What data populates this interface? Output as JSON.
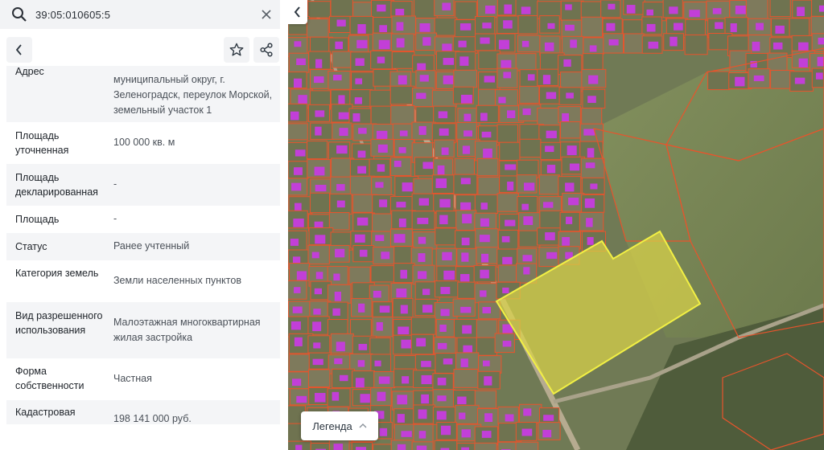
{
  "search": {
    "query": "39:05:010605:5"
  },
  "toolbar": {
    "back": "back",
    "favorite": "star",
    "share": "share"
  },
  "rows": [
    {
      "label": "Адрес",
      "value": "муниципальный округ, г. Зеленоградск, переулок Морской, земельный участок 1"
    },
    {
      "label": "Площадь уточненная",
      "value": "100 000 кв. м"
    },
    {
      "label": "Площадь декларированная",
      "value": "-"
    },
    {
      "label": "Площадь",
      "value": "-"
    },
    {
      "label": "Статус",
      "value": "Ранее учтенный"
    },
    {
      "label": "Категория земель",
      "value": "Земли населенных пунктов"
    },
    {
      "label": "Вид разрешенного использования",
      "value": "Малоэтажная многоквартирная жилая застройка"
    },
    {
      "label": "Форма собственности",
      "value": "Частная"
    },
    {
      "label": "Кадастровая стоимость",
      "value": "198 141 000 руб."
    }
  ],
  "map": {
    "legend_label": "Легенда",
    "colors": {
      "parcel_outline": "#e8542c",
      "highlight_fill": "#d9d24a",
      "highlight_stroke": "#f2f044",
      "building": "#c23fd8",
      "field": "#7d8a58",
      "urban": "#7b7b5e"
    }
  },
  "icons": {
    "search": "search-icon",
    "clear": "close-icon",
    "collapse": "chevron-left-icon",
    "legend": "chevron-up-icon"
  }
}
